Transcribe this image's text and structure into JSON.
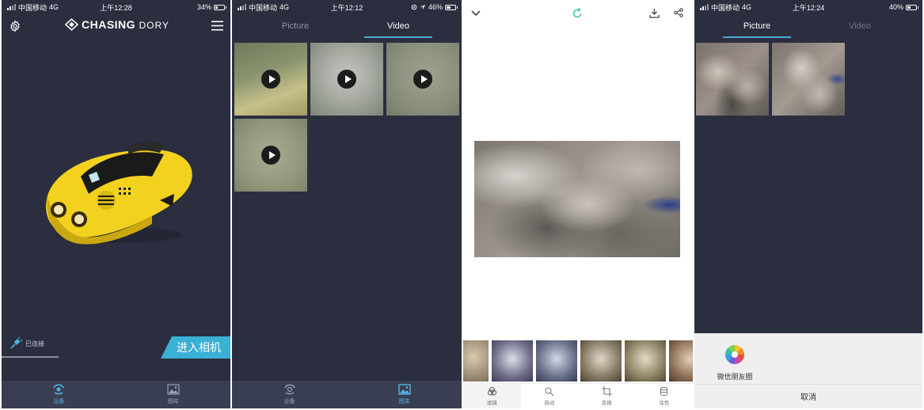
{
  "screen1": {
    "status": {
      "carrier": "中国移动",
      "network": "4G",
      "time": "上午12:28",
      "battery": "34%",
      "battery_level": 0.34
    },
    "brand": {
      "name": "CHASING",
      "sub": "DORY"
    },
    "connection": {
      "label": "已连接"
    },
    "enter_camera": "进入相机",
    "tabs": [
      {
        "label": "设备"
      },
      {
        "label": "图库"
      }
    ],
    "icons": {
      "settings": "gear-icon",
      "menu": "menu-icon",
      "device_tab": "drone-icon",
      "gallery_tab": "gallery-icon",
      "connected": "plug-icon"
    }
  },
  "screen2": {
    "status": {
      "carrier": "中国移动",
      "network": "4G",
      "time": "上午12:12",
      "battery": "46%",
      "battery_level": 0.46
    },
    "tabs": [
      {
        "label": "Picture"
      },
      {
        "label": "Video"
      }
    ],
    "active_tab": "Video",
    "videos": [
      {
        "id": "v1"
      },
      {
        "id": "v2"
      },
      {
        "id": "v3"
      },
      {
        "id": "v4"
      }
    ],
    "bottom_tabs": [
      {
        "label": "设备"
      },
      {
        "label": "图库"
      }
    ]
  },
  "screen3": {
    "tools": [
      {
        "label": "滤镜"
      },
      {
        "label": "自动"
      },
      {
        "label": "变换"
      },
      {
        "label": "涂色"
      }
    ],
    "icons": {
      "collapse": "chevron-down-icon",
      "reset": "rotate-icon",
      "download": "download-icon",
      "share": "share-icon"
    }
  },
  "screen4": {
    "status": {
      "carrier": "中国移动",
      "network": "4G",
      "time": "上午12:24",
      "battery": "40%",
      "battery_level": 0.4
    },
    "tabs": [
      {
        "label": "Picture"
      },
      {
        "label": "Video"
      }
    ],
    "active_tab": "Picture",
    "share": {
      "moments_label": "微信朋友圈",
      "cancel_label": "取消"
    }
  },
  "colors": {
    "bg_dark": "#2b2e3f",
    "accent": "#4aa8d8",
    "enter_camera_bg": "#3ab0d5",
    "tabbar": "#3a3e52"
  }
}
